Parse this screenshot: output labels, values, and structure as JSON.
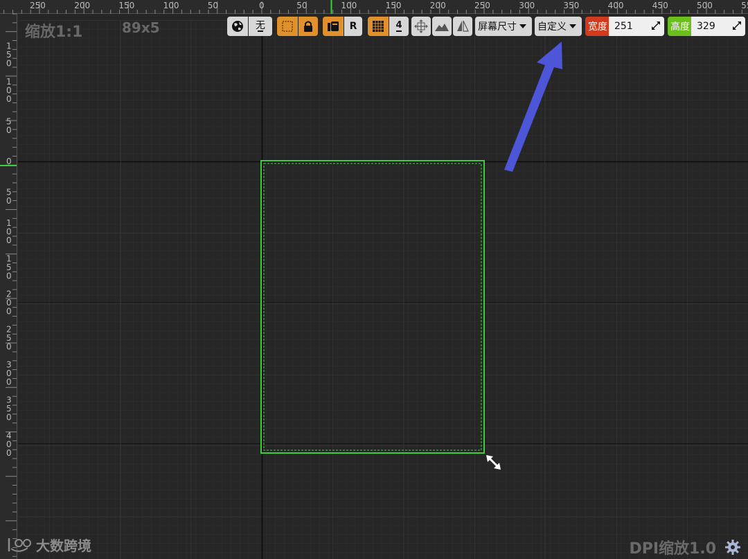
{
  "overlay": {
    "zoom_label": "缩放1:1",
    "size_label": "89x5",
    "dpi_label": "DPI缩放1.0",
    "brand": "大数跨境"
  },
  "ruler": {
    "top_labels": [
      "250",
      "200",
      "150",
      "100",
      "50",
      "0",
      "50",
      "100",
      "150",
      "200",
      "250",
      "300",
      "350",
      "400",
      "450",
      "500",
      "55"
    ],
    "left_labels": [
      [
        "1",
        "5",
        "0"
      ],
      [
        "1",
        "0",
        "0"
      ],
      [
        "5",
        "0"
      ],
      [
        "0"
      ],
      [
        "5",
        "0"
      ],
      [
        "1",
        "0",
        "0"
      ],
      [
        "1",
        "5",
        "0"
      ],
      [
        "2",
        "0",
        "0"
      ],
      [
        "2",
        "5",
        "0"
      ],
      [
        "3",
        "0",
        "0"
      ],
      [
        "3",
        "5",
        "0"
      ],
      [
        "4",
        "0",
        "0"
      ]
    ]
  },
  "toolbar": {
    "world_icon": "globe-icon",
    "none_label": "无",
    "lock_icon": "lock-icon",
    "r_label": "R",
    "grid_icon": "grid-icon",
    "grid_value": "4",
    "screen_size_label": "屏幕尺寸",
    "custom_label": "自定义",
    "width_label": "宽度",
    "width_value": "251",
    "height_label": "高度",
    "height_value": "329"
  },
  "colors": {
    "selection_green": "#3cd13c",
    "accent_orange": "#e0912c",
    "width_red": "#d23a1e",
    "height_green": "#6bbf1a",
    "arrow_blue": "#4c56d6"
  }
}
